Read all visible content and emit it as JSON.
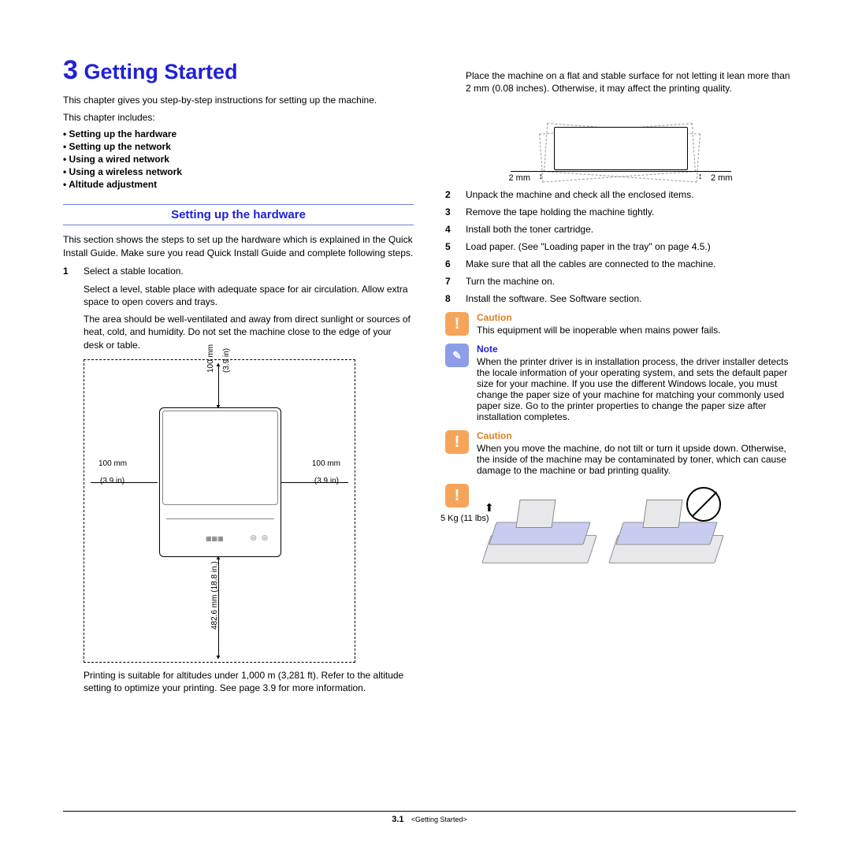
{
  "header": {
    "chapter_number": "3",
    "chapter_title": "Getting Started"
  },
  "intro": {
    "p1": "This chapter gives you step-by-step instructions for setting up the machine.",
    "p2": "This chapter includes:",
    "toc": [
      "Setting up the hardware",
      "Setting up the network",
      "Using a wired network",
      "Using a wireless network",
      "Altitude adjustment"
    ]
  },
  "section": {
    "title": "Setting up the hardware",
    "intro": "This section shows the steps to set up the hardware which is explained in the Quick Install Guide. Make sure you read Quick Install Guide and complete following steps."
  },
  "steps_left": {
    "s1_num": "1",
    "s1_text": "Select a stable location.",
    "s1_sub1": "Select a level, stable place with adequate space for air circulation. Allow extra space to open covers and trays.",
    "s1_sub2": "The area should be well-ventilated and away from direct sunlight or sources of heat, cold, and humidity. Do not set the machine close to the edge of your desk or table."
  },
  "spacing_diagram": {
    "top_mm": "100 mm",
    "top_in": "(3.9 in)",
    "left_mm": "100 mm",
    "left_in": "(3.9 in)",
    "right_mm": "100 mm",
    "right_in": "(3.9 in)",
    "bottom": "482.6 mm (18.8 in.)"
  },
  "altitude_note": "Printing is suitable for altitudes under 1,000 m (3,281 ft). Refer to the altitude setting to optimize your printing. See page 3.9 for more information.",
  "right_intro": "Place the machine on a flat and stable surface for not letting it lean more than 2 mm (0.08 inches). Otherwise, it may affect the printing quality.",
  "tilt": {
    "left": "2 mm",
    "right": "2 mm"
  },
  "steps_right": [
    {
      "num": "2",
      "text": "Unpack the machine and check all the enclosed items."
    },
    {
      "num": "3",
      "text": "Remove the tape holding the machine tightly."
    },
    {
      "num": "4",
      "text": "Install both the toner cartridge."
    },
    {
      "num": "5",
      "text": "Load paper. (See \"Loading paper in the tray\" on page 4.5.)"
    },
    {
      "num": "6",
      "text": "Make sure that all the cables are connected to the machine."
    },
    {
      "num": "7",
      "text": "Turn the machine on."
    },
    {
      "num": "8",
      "text": "Install the software. See Software section."
    }
  ],
  "callouts": {
    "caution1_title": "Caution",
    "caution1_text": "This equipment will be inoperable when mains power fails.",
    "note_title": "Note",
    "note_text": "When the printer driver is in installation process, the driver installer detects the locale information of your operating system, and sets the default paper size for your machine. If you use the different Windows locale, you must change the paper size of your machine for matching your commonly used paper size. Go to the printer properties to change the paper size after installation completes.",
    "caution2_title": "Caution",
    "caution2_text": "When you move the machine, do not tilt or turn it upside down. Otherwise, the inside of the machine may be contaminated by toner, which can cause damage to the machine or bad printing quality."
  },
  "weight": {
    "label": "5 Kg (11 lbs)"
  },
  "footer": {
    "page": "3.1",
    "chapter": "<Getting Started>"
  }
}
